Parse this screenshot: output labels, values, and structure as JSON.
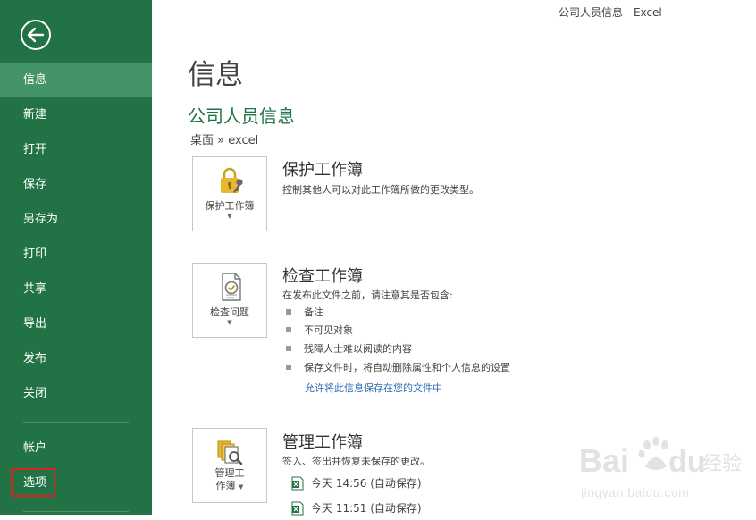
{
  "window": {
    "title": "公司人员信息 - Excel"
  },
  "sidebar": {
    "back_icon": "back-arrow-icon",
    "items": [
      {
        "label": "信息",
        "active": true
      },
      {
        "label": "新建"
      },
      {
        "label": "打开"
      },
      {
        "label": "保存"
      },
      {
        "label": "另存为"
      },
      {
        "label": "打印"
      },
      {
        "label": "共享"
      },
      {
        "label": "导出"
      },
      {
        "label": "发布"
      },
      {
        "label": "关闭"
      }
    ],
    "bottom_items": [
      {
        "label": "帐户"
      },
      {
        "label": "选项",
        "highlighted": true
      }
    ],
    "color": "#217346",
    "active_color": "#439467",
    "highlight_color": "#e81d1d"
  },
  "main": {
    "page_title": "信息",
    "doc_title": "公司人员信息",
    "doc_path": "桌面 » excel",
    "protect": {
      "button_label": "保护工作簿",
      "heading": "保护工作簿",
      "description": "控制其他人可以对此工作簿所做的更改类型。",
      "icon": "lock-key-icon"
    },
    "inspect": {
      "button_label": "检查问题",
      "heading": "检查工作簿",
      "description": "在发布此文件之前，请注意其是否包含:",
      "bullets": [
        "备注",
        "不可见对象",
        "残障人士难以阅读的内容",
        "保存文件时，将自动删除属性和个人信息的设置"
      ],
      "link": "允许将此信息保存在您的文件中",
      "icon": "document-inspect-icon"
    },
    "manage": {
      "button_label_line1": "管理工",
      "button_label_line2": "作簿",
      "heading": "管理工作簿",
      "description": "签入、签出并恢复未保存的更改。",
      "versions": [
        "今天 14:56 (自动保存)",
        "今天 11:51 (自动保存)"
      ],
      "icon": "manage-versions-icon"
    }
  },
  "watermark": {
    "brand": "Bai",
    "brand2": "du",
    "suffix": "经验",
    "url": "jingyan.baidu.com"
  }
}
